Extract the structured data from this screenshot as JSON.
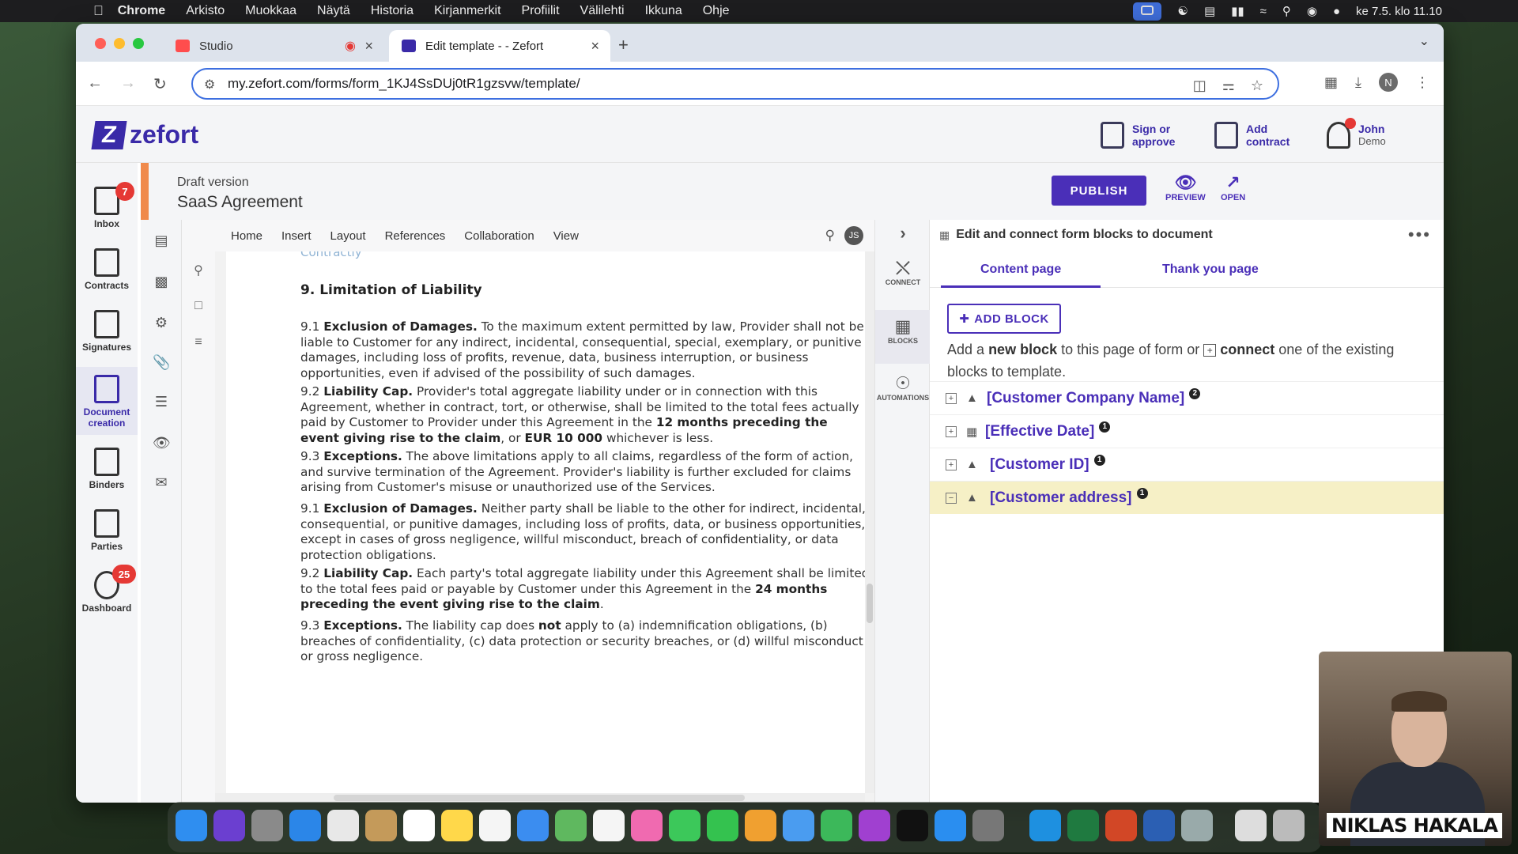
{
  "menubar": {
    "app": "Chrome",
    "items": [
      "Arkisto",
      "Muokkaa",
      "Näytä",
      "Historia",
      "Kirjanmerkit",
      "Profiilit",
      "Välilehti",
      "Ikkuna",
      "Ohje"
    ],
    "clock": "ke 7.5. klo 11.10"
  },
  "browser": {
    "tabs": [
      {
        "title": "Studio",
        "active": false
      },
      {
        "title": "Edit template - - Zefort",
        "active": true
      }
    ],
    "url": "my.zefort.com/forms/form_1KJ4SsDUj0tR1gzsvw/template/",
    "profile_initial": "N"
  },
  "header": {
    "logo": "zefort",
    "sign": "Sign or approve",
    "add": "Add contract",
    "user_name": "John",
    "user_org": "Demo"
  },
  "leftnav": [
    {
      "label": "Inbox",
      "badge": "7"
    },
    {
      "label": "Contracts"
    },
    {
      "label": "Signatures"
    },
    {
      "label": "Document creation",
      "active": true
    },
    {
      "label": "Binders"
    },
    {
      "label": "Parties"
    },
    {
      "label": "Dashboard",
      "badge": "25"
    }
  ],
  "draft": {
    "status": "Draft version",
    "title": "SaaS Agreement",
    "publish": "PUBLISH",
    "preview": "PREVIEW",
    "open": "OPEN"
  },
  "editor": {
    "tabs": [
      "Home",
      "Insert",
      "Layout",
      "References",
      "Collaboration",
      "View"
    ],
    "avatar": "JS",
    "faint_heading": "Contractly",
    "heading": "9. Limitation of Liability",
    "paragraphs": [
      {
        "num": "9.1",
        "title": "Exclusion of Damages.",
        "text": "To the maximum extent permitted by law, Provider shall not be liable to Customer for any indirect, incidental, consequential, special, exemplary, or punitive damages, including loss of profits, revenue, data, business interruption, or business opportunities, even if advised of the possibility of such damages."
      },
      {
        "num": "9.2",
        "title": "Liability Cap.",
        "text_a": "Provider's total aggregate liability under or in connection with this Agreement, whether in contract, tort, or otherwise, shall be limited to the total fees actually paid by Customer to Provider under this Agreement in the",
        "bold_a": "12 months preceding the event giving rise to the claim",
        "text_b": ", or",
        "bold_b": "EUR 10 000",
        "text_c": "whichever is less."
      },
      {
        "num": "9.3",
        "title": "Exceptions.",
        "text": "The above limitations apply to all claims, regardless of the form of action, and survive termination of the Agreement. Provider's liability is further excluded for claims arising from Customer's misuse or unauthorized use of the Services."
      },
      {
        "num": "9.1",
        "title": "Exclusion of Damages.",
        "text": "Neither party shall be liable to the other for indirect, incidental, consequential, or punitive damages, including loss of profits, data, or business opportunities, except in cases of gross negligence, willful misconduct, breach of confidentiality, or data protection obligations."
      },
      {
        "num": "9.2",
        "title": "Liability Cap.",
        "text_a": "Each party's total aggregate liability under this Agreement shall be limited to the total fees paid or payable by Customer under this Agreement in the",
        "bold_a": "24 months preceding the event giving rise to the claim",
        "text_b": "."
      },
      {
        "num": "9.3",
        "title": "Exceptions.",
        "text_a": "The liability cap does",
        "bold_a": "not",
        "text_b": "apply to (a) indemnification obligations, (b) breaches of confidentiality, (c) data protection or security breaches, or (d) willful misconduct or gross negligence."
      }
    ]
  },
  "connect": {
    "connect": "CONNECT",
    "blocks": "BLOCKS",
    "automations": "AUTOMATIONS"
  },
  "panel": {
    "title": "Edit and connect form blocks to document",
    "tab_content": "Content page",
    "tab_thanks": "Thank you page",
    "add_block": "ADD BLOCK",
    "help_a": "Add a",
    "help_b": "new block",
    "help_c": "to this page of form or",
    "help_d": "connect",
    "help_e": "one of the existing blocks to template.",
    "blocks": [
      {
        "name": "[Customer Company Name]",
        "count": "2",
        "type": "text"
      },
      {
        "name": "[Effective Date]",
        "count": "1",
        "type": "date"
      },
      {
        "name": "[Customer ID]",
        "count": "1",
        "type": "text"
      },
      {
        "name": "[Customer address]",
        "count": "1",
        "type": "text",
        "expanded": true
      }
    ]
  },
  "webcam": {
    "name": "NIKLAS HAKALA"
  }
}
